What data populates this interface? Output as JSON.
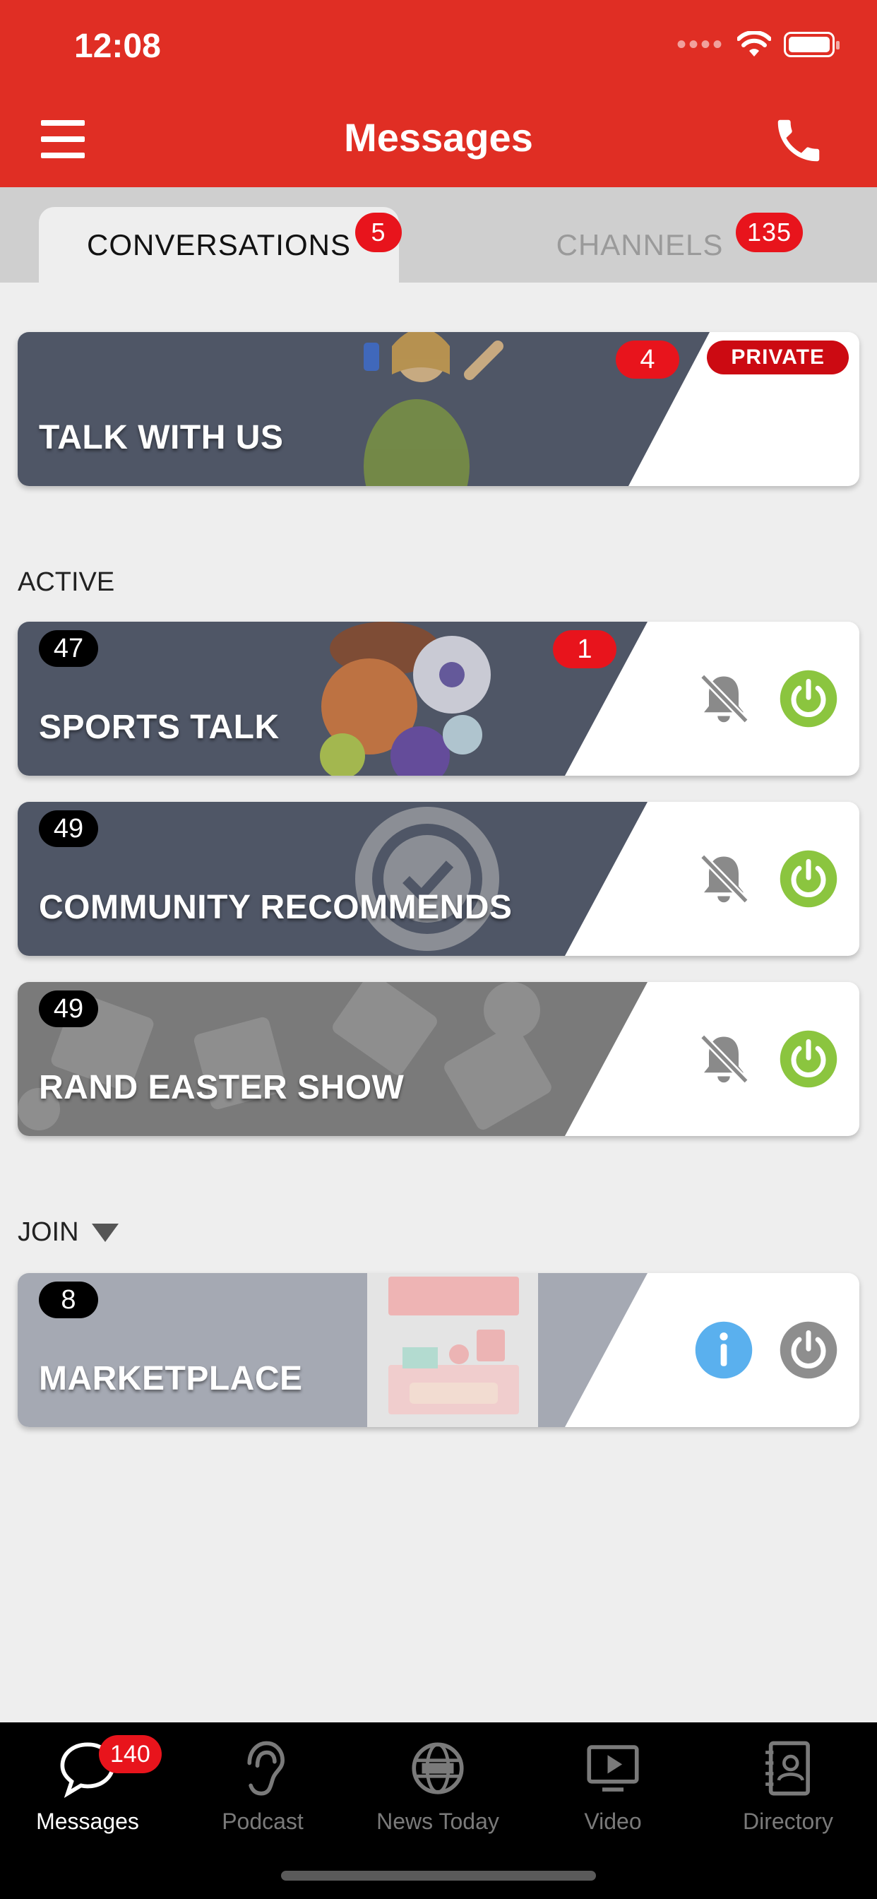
{
  "status_bar": {
    "time": "12:08"
  },
  "header": {
    "title": "Messages"
  },
  "tabs": [
    {
      "label": "CONVERSATIONS",
      "badge": "5",
      "active": true
    },
    {
      "label": "CHANNELS",
      "badge": "135",
      "active": false
    }
  ],
  "featured": {
    "name": "TALK WITH US",
    "unread": "4",
    "tag": "PRIVATE"
  },
  "sections": {
    "active": "ACTIVE",
    "join": "JOIN"
  },
  "active_channels": [
    {
      "name": "SPORTS TALK",
      "members": "47",
      "unread": "1",
      "muted": true,
      "powered": true
    },
    {
      "name": "COMMUNITY RECOMMENDS",
      "members": "49",
      "muted": true,
      "powered": true
    },
    {
      "name": "RAND EASTER SHOW",
      "members": "49",
      "muted": true,
      "powered": true
    }
  ],
  "join_channels": [
    {
      "name": "MARKETPLACE",
      "members": "8"
    }
  ],
  "bottom_nav": [
    {
      "label": "Messages",
      "icon": "chat-bubble-icon",
      "badge": "140",
      "active": true
    },
    {
      "label": "Podcast",
      "icon": "ear-icon"
    },
    {
      "label": "News Today",
      "icon": "globe-news-icon"
    },
    {
      "label": "Video",
      "icon": "video-play-icon"
    },
    {
      "label": "Directory",
      "icon": "contact-book-icon"
    }
  ],
  "colors": {
    "brand_red": "#e02e24",
    "badge_red": "#e8141c",
    "power_green": "#8bc53f",
    "info_blue": "#5ab0ee",
    "card_slate": "#4f5666"
  }
}
